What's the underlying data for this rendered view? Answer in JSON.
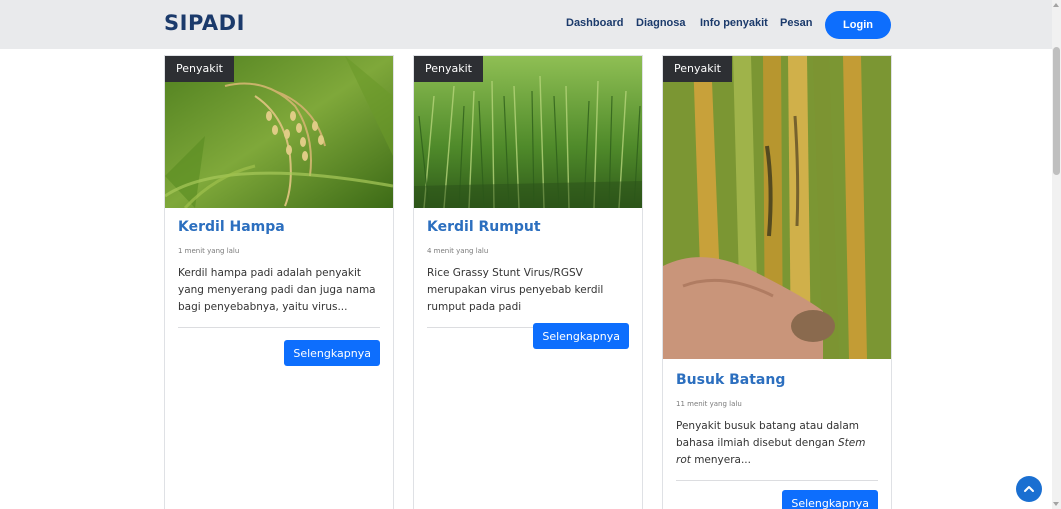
{
  "navbar": {
    "brand": "SIPADI",
    "links": [
      "Dashboard",
      "Diagnosa",
      "Info penyakit",
      "Pesan"
    ],
    "login_label": "Login",
    "accent_color": "#0d6efd",
    "brand_color": "#1b3a6b"
  },
  "cards": [
    {
      "badge": "Penyakit",
      "image": "rice-panicles-photo",
      "title": "Kerdil Hampa",
      "time": "1 menit yang lalu",
      "excerpt": "Kerdil hampa padi adalah penyakit yang menyerang padi dan juga nama bagi penyebabnya, yaitu virus...",
      "button": "Selengkapnya"
    },
    {
      "badge": "Penyakit",
      "image": "rice-field-rows-photo",
      "title": "Kerdil Rumput",
      "time": "4 menit yang lalu",
      "excerpt": "Rice Grassy Stunt Virus/RGSV merupakan virus penyebab kerdil rumput pada padi",
      "button": "Selengkapnya"
    },
    {
      "badge": "Penyakit",
      "image": "rice-stem-rot-closeup-photo",
      "title": "Busuk Batang",
      "time": "11 menit yang lalu",
      "excerpt_before": "Penyakit busuk batang atau dalam bahasa ilmiah disebut dengan ",
      "excerpt_em": "Stem rot",
      "excerpt_after": " menyera...",
      "button": "Selengkapnya"
    }
  ],
  "back_to_top_icon": "chevron-up-icon"
}
